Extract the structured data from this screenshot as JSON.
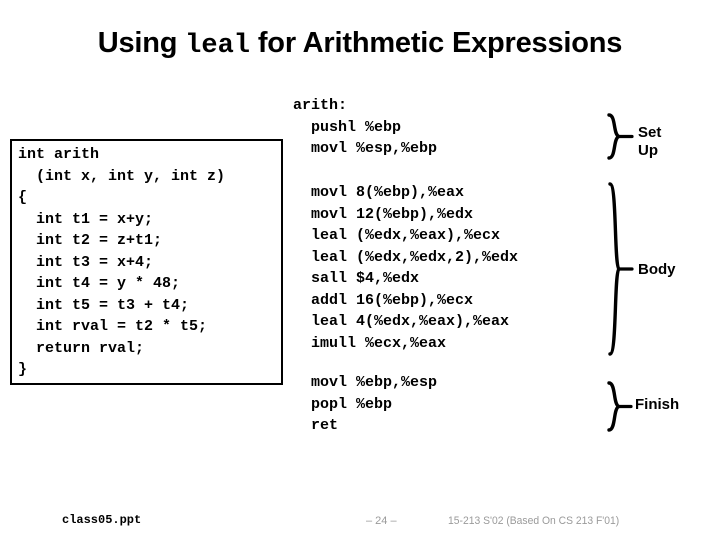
{
  "slide": {
    "title_prefix": "Using ",
    "title_mono": "leal",
    "title_suffix": " for Arithmetic Expressions",
    "title_full": "Using leal for Arithmetic Expressions"
  },
  "c_code": {
    "text": "int arith\n  (int x, int y, int z)\n{\n  int t1 = x+y;\n  int t2 = z+t1;\n  int t3 = x+4;\n  int t4 = y * 48;\n  int t5 = t3 + t4;\n  int rval = t2 * t5;\n  return rval;\n}",
    "lines": [
      "int arith",
      "  (int x, int y, int z)",
      "{",
      "  int t1 = x+y;",
      "  int t2 = z+t1;",
      "  int t3 = x+4;",
      "  int t4 = y * 48;",
      "  int t5 = t3 + t4;",
      "  int rval = t2 * t5;",
      "  return rval;",
      "}"
    ]
  },
  "assembly": {
    "setup": {
      "label": "Set\nUp",
      "text": "arith:\n  pushl %ebp\n  movl %esp,%ebp",
      "lines": [
        "arith:",
        "  pushl %ebp",
        "  movl %esp,%ebp"
      ]
    },
    "body": {
      "label": "Body",
      "text": "  movl 8(%ebp),%eax\n  movl 12(%ebp),%edx\n  leal (%edx,%eax),%ecx\n  leal (%edx,%edx,2),%edx\n  sall $4,%edx\n  addl 16(%ebp),%ecx\n  leal 4(%edx,%eax),%eax\n  imull %ecx,%eax",
      "lines": [
        "  movl 8(%ebp),%eax",
        "  movl 12(%ebp),%edx",
        "  leal (%edx,%eax),%ecx",
        "  leal (%edx,%edx,2),%edx",
        "  sall $4,%edx",
        "  addl 16(%ebp),%ecx",
        "  leal 4(%edx,%eax),%eax",
        "  imull %ecx,%eax"
      ]
    },
    "finish": {
      "label": "Finish",
      "text": "  movl %ebp,%esp\n  popl %ebp\n  ret",
      "lines": [
        "  movl %ebp,%esp",
        "  popl %ebp",
        "  ret"
      ]
    }
  },
  "footer": {
    "filename": "class05.ppt",
    "page": "– 24 –",
    "course": "15-213 S'02 (Based On CS 213 F'01)"
  },
  "colors": {
    "text": "#000000",
    "background": "#ffffff",
    "footer_gray": "#9a9a9a",
    "box_border": "#000000"
  }
}
